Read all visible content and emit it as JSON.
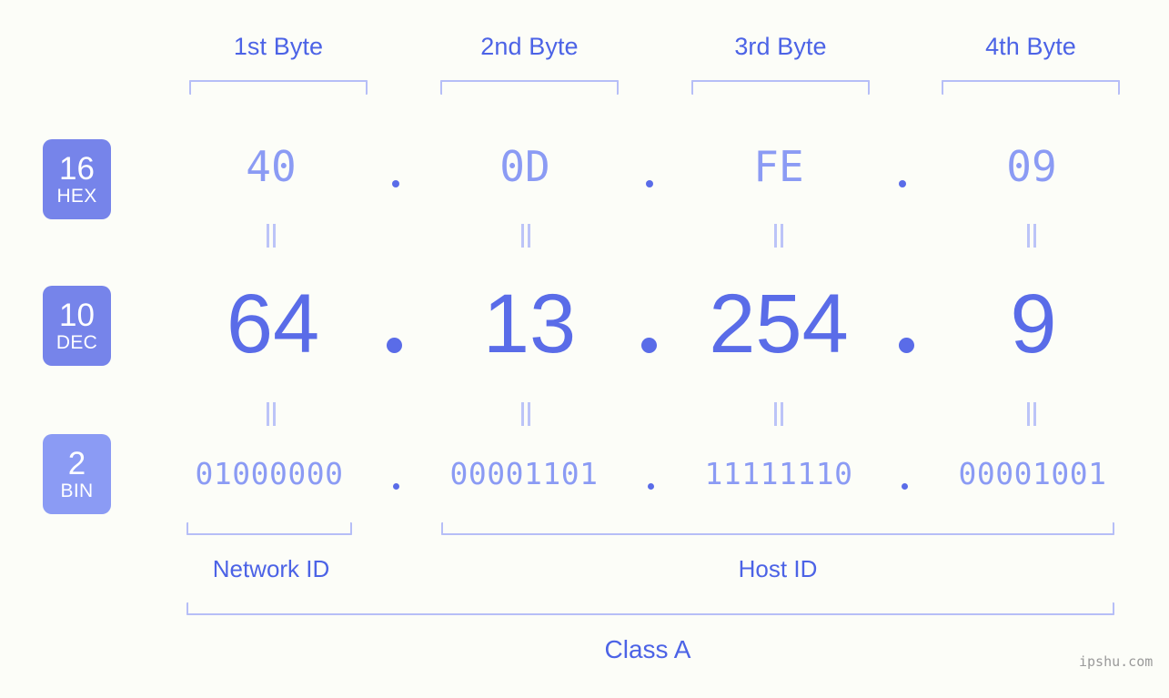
{
  "diagram": {
    "title": "IP Address Byte Breakdown",
    "background_color": "#fcfdf8",
    "accent_color": "#5a6ce8",
    "accent_light_color": "#8b9bf4",
    "bracket_color": "#b6bef7"
  },
  "byte_headers": [
    {
      "label": "1st Byte"
    },
    {
      "label": "2nd Byte"
    },
    {
      "label": "3rd Byte"
    },
    {
      "label": "4th Byte"
    }
  ],
  "bases": [
    {
      "number": "16",
      "name": "HEX"
    },
    {
      "number": "10",
      "name": "DEC"
    },
    {
      "number": "2",
      "name": "BIN"
    }
  ],
  "rows": {
    "hex": {
      "base": "16",
      "name": "HEX",
      "values": [
        "40",
        "0D",
        "FE",
        "09"
      ],
      "separator": "."
    },
    "dec": {
      "base": "10",
      "name": "DEC",
      "values": [
        "64",
        "13",
        "254",
        "9"
      ],
      "separator": "."
    },
    "bin": {
      "base": "2",
      "name": "BIN",
      "values": [
        "01000000",
        "00001101",
        "11111110",
        "00001001"
      ],
      "separator": "."
    }
  },
  "equality_marks": {
    "symbol": "=",
    "count_per_row": 4,
    "rows": 2
  },
  "segments": [
    {
      "label": "Network ID"
    },
    {
      "label": "Host ID"
    }
  ],
  "class": {
    "label": "Class A"
  },
  "watermark": {
    "text": "ipshu.com"
  }
}
